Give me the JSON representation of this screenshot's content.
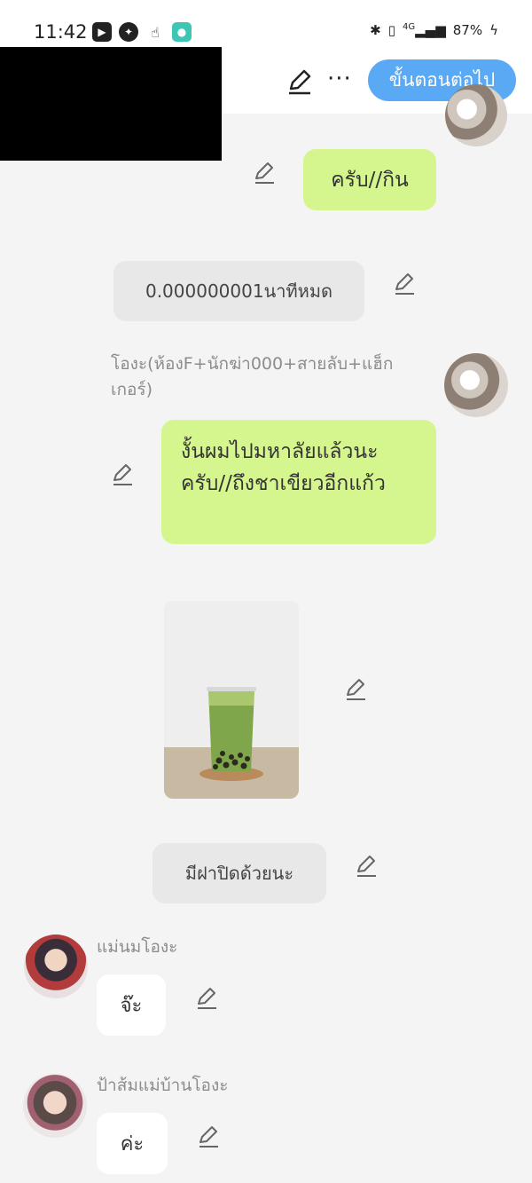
{
  "status": {
    "time": "11:42",
    "battery": "87%",
    "network": "4G"
  },
  "header": {
    "next_label": "ขั้นตอนต่อไป",
    "more_label": "···"
  },
  "messages": {
    "m1_text": "ครับ//กิน",
    "m2_text": "0.000000001นาทีหมด",
    "m3_sender": "โองะ(ห้องF+นักฆ่า000+สายลับ+แฮ็กเกอร์)",
    "m3_text": "งั้นผมไปมหาลัยแล้วนะครับ//ถึงชาเขียวอีกแก้ว",
    "m5_text": "มีฝาปิดด้วยนะ",
    "m6_sender": "แม่นมโองะ",
    "m6_text": "จ๊ะ",
    "m7_sender": "ป้าส้มแม่บ้านโองะ",
    "m7_text": "ค่ะ"
  },
  "colors": {
    "accent": "#5aa9f4",
    "bubble_green": "#d5f58f",
    "bubble_grey": "#e8e8e8",
    "background": "#f4f4f4"
  },
  "icons": [
    "pen-icon",
    "more-icon",
    "bluetooth-icon",
    "vibrate-icon",
    "signal-icon",
    "battery-icon",
    "youtube-icon",
    "messenger-icon"
  ]
}
